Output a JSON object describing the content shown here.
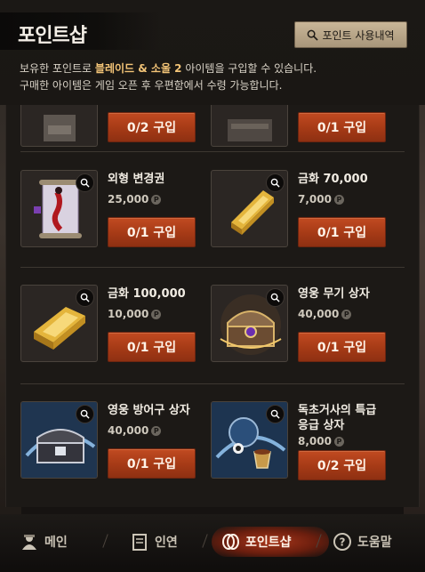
{
  "header": {
    "title": "포인트샵",
    "history_button": "포인트 사용내역",
    "desc_line1_prefix": "보유한 포인트로 ",
    "desc_line1_highlight": "블레이드 & 소울 2",
    "desc_line1_suffix": " 아이템을 구입할 수 있습니다.",
    "desc_line2": "구매한 아이템은 게임 오픈 후 우편함에서 수령 가능합니다."
  },
  "items": [
    {
      "name": "",
      "price": "",
      "buy_label": "0/2 구입",
      "icon": "hero-box-icon"
    },
    {
      "name": "",
      "price": "",
      "buy_label": "0/1 구입",
      "icon": "hero-chest-icon"
    },
    {
      "name": "외형 변경권",
      "price": "25,000",
      "buy_label": "0/1 구입",
      "icon": "scroll-icon"
    },
    {
      "name": "금화 70,000",
      "price": "7,000",
      "buy_label": "0/1 구입",
      "icon": "gold-bar-icon"
    },
    {
      "name": "금화 100,000",
      "price": "10,000",
      "buy_label": "0/1 구입",
      "icon": "gold-bar-icon"
    },
    {
      "name": "영웅 무기 상자",
      "price": "40,000",
      "buy_label": "0/1 구입",
      "icon": "weapon-chest-icon"
    },
    {
      "name": "영웅 방어구 상자",
      "price": "40,000",
      "buy_label": "0/1 구입",
      "icon": "armor-chest-icon"
    },
    {
      "name": "독초거사의 특급 응급 상자",
      "price": "8,000",
      "buy_label": "0/2 구입",
      "icon": "herb-pouch-icon"
    }
  ],
  "point_symbol": "P",
  "nav": {
    "main": "메인",
    "relation": "인연",
    "pointshop": "포인트샵",
    "help": "도움말"
  },
  "colors": {
    "accent": "#b8421b",
    "highlight": "#f3c477"
  }
}
